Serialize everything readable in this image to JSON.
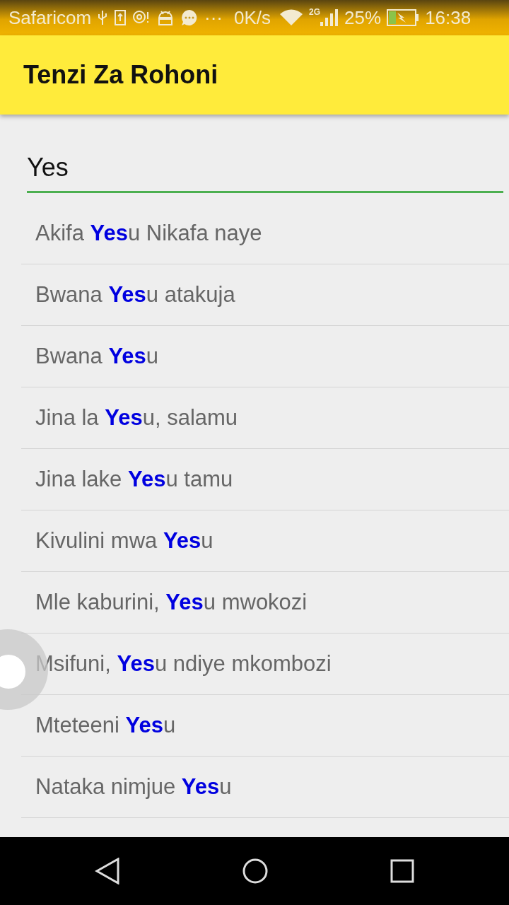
{
  "status_bar": {
    "carrier": "Safaricom",
    "more": "···",
    "speed": "0K/s",
    "network": "2G",
    "battery": "25%",
    "time": "16:38"
  },
  "app_bar": {
    "title": "Tenzi Za Rohoni"
  },
  "search": {
    "value": "Yes"
  },
  "results": [
    {
      "title": "Akifa **Yes**u Nikafa naye"
    },
    {
      "title": "Bwana **Yes**u atakuja"
    },
    {
      "title": "Bwana **Yes**u"
    },
    {
      "title": "Jina la **Yes**u, salamu"
    },
    {
      "title": "Jina lake **Yes**u tamu"
    },
    {
      "title": "Kivulini mwa **Yes**u"
    },
    {
      "title": "Mle kaburini, **Yes**u mwokozi"
    },
    {
      "title": "Msifuni, **Yes**u ndiye mkombozi"
    },
    {
      "title": "Mteteeni **Yes**u"
    },
    {
      "title": "Nataka nimjue **Yes**u"
    }
  ]
}
